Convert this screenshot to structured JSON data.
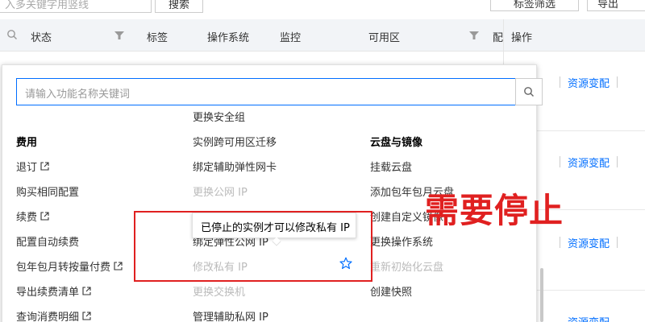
{
  "top": {
    "search_placeholder": "入多关键字用竖线",
    "search_button": "搜索",
    "button_1": "标签筛选",
    "button_2": "导出"
  },
  "table": {
    "headers": [
      "状态",
      "标签",
      "操作系统",
      "监控",
      "可用区",
      "配",
      "操作"
    ],
    "row_links": [
      "资源变配",
      "资源变配",
      "资源变配",
      "资源变配"
    ]
  },
  "panel": {
    "search_placeholder": "请输入功能名称关键词",
    "col1": {
      "title": "费用",
      "items": [
        "退订",
        "购买相同配置",
        "续费",
        "配置自动续费",
        "包年包月转按量付费",
        "导出续费清单",
        "查询消费明细"
      ]
    },
    "col2": {
      "items": [
        "更换安全组",
        "实例跨可用区迁移",
        "绑定辅助弹性网卡",
        "更换公网 IP",
        "绑定弹性公网 IP",
        "修改私有 IP",
        "更换交换机",
        "管理辅助私网 IP"
      ]
    },
    "col3": {
      "title": "云盘与镜像",
      "items": [
        "挂载云盘",
        "添加包年包月云盘",
        "创建自定义镜像",
        "更换操作系统",
        "重新初始化云盘",
        "创建快照"
      ]
    }
  },
  "tooltip": "已停止的实例才可以修改私有 IP",
  "annotation": "需要停止",
  "colors": {
    "accent": "#006eff",
    "annotation": "#e02020"
  }
}
